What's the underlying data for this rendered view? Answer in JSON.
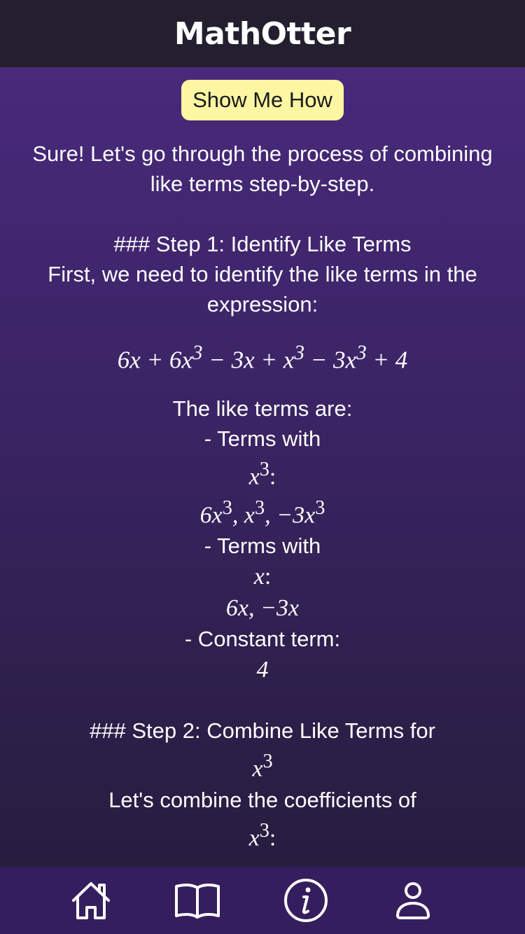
{
  "header": {
    "title": "MathOtter"
  },
  "content": {
    "show_button_label": "Show Me How",
    "intro": "Sure! Let's go through the process of combining like terms step-by-step.",
    "step1_heading": "### Step 1: Identify Like Terms",
    "step1_text": "First, we need to identify the like terms in the expression:",
    "like_terms_label": "The like terms are:",
    "terms_with_label": "- Terms with",
    "constant_term_label": "- Constant term:",
    "constant_value": "4",
    "step2_heading": "### Step 2: Combine Like Terms for",
    "step2_text": "Let's combine the coefficients of"
  },
  "nav": {
    "items": [
      {
        "icon": "home-icon"
      },
      {
        "icon": "book-icon"
      },
      {
        "icon": "info-icon"
      },
      {
        "icon": "user-icon"
      }
    ]
  },
  "colors": {
    "header_bg": "#231f2e",
    "nav_bg": "#351e5e",
    "button_bg": "#fdf6a3",
    "gradient_top": "#48297b",
    "gradient_bottom": "#271d3f"
  }
}
